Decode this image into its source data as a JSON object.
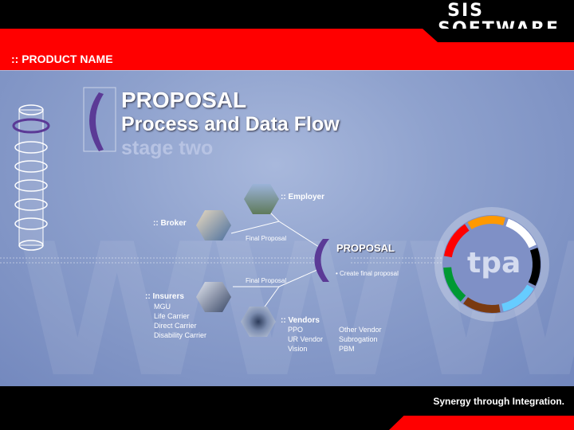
{
  "header": {
    "logo_line1": "SIS",
    "logo_line2": "SOFTWARE",
    "product_name": ":: PRODUCT NAME"
  },
  "title": {
    "line1": "PROPOSAL",
    "line2": "Process and Data Flow",
    "line3": "stage two"
  },
  "nodes": {
    "employer": ":: Employer",
    "broker": ":: Broker",
    "insurers": ":: Insurers",
    "insurers_items": [
      "MGU",
      "Life Carrier",
      "Direct Carrier",
      "Disability Carrier"
    ],
    "vendors": ":: Vendors",
    "vendors_col1": [
      "PPO",
      "UR Vendor",
      "Vision"
    ],
    "vendors_col2": [
      "Other Vendor",
      "Subrogation",
      "PBM"
    ]
  },
  "flow": {
    "final_proposal_top": "Final Proposal",
    "final_proposal_bottom": "Final Proposal",
    "proposal_label": "PROPOSAL",
    "proposal_sub": "• Create final proposal"
  },
  "badge": {
    "text": "tpa"
  },
  "footer": {
    "tagline": "Synergy through Integration."
  },
  "colors": {
    "red": "#ff0000",
    "background": "#8ea1cd",
    "accent_purple": "#5b3a96",
    "ring": [
      "#ff0000",
      "#ff9900",
      "#ffffff",
      "#000000",
      "#66ccff",
      "#7a3a10",
      "#009933"
    ]
  },
  "icons": [
    "tower-icon",
    "bracket-icon",
    "employer-photo",
    "broker-photo",
    "insurers-photo",
    "vendors-photo",
    "tpa-ring-icon"
  ]
}
